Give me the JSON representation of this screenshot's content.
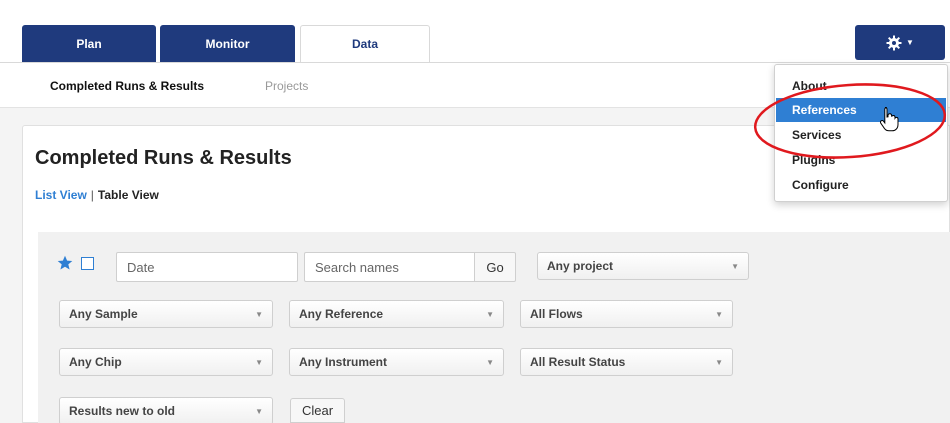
{
  "tabs": [
    {
      "label": "Plan",
      "active": false
    },
    {
      "label": "Monitor",
      "active": false
    },
    {
      "label": "Data",
      "active": true
    }
  ],
  "subnav": {
    "current": "Completed Runs & Results",
    "other": "Projects"
  },
  "page": {
    "title": "Completed Runs & Results",
    "list_view": "List View",
    "separator": "|",
    "table_view": "Table View"
  },
  "filters": {
    "date_placeholder": "Date",
    "search_placeholder": "Search names",
    "go_label": "Go",
    "project": "Any project",
    "sample": "Any Sample",
    "reference": "Any Reference",
    "flows": "All Flows",
    "chip": "Any Chip",
    "instrument": "Any Instrument",
    "result_status": "All Result Status",
    "sort": "Results new to old",
    "clear_label": "Clear"
  },
  "settings_menu": {
    "items": [
      {
        "label": "About"
      },
      {
        "label": "References",
        "highlighted": true
      },
      {
        "label": "Services"
      },
      {
        "label": "Plugins"
      },
      {
        "label": "Configure"
      }
    ]
  },
  "icons": {
    "settings": "gear-icon",
    "favorite": "star-icon",
    "cursor": "hand-pointer-icon"
  },
  "colors": {
    "nav_dark": "#1f3a7d",
    "link_blue": "#2f7fd3",
    "highlight": "#2f7fd3",
    "annotation_red": "#e0191e"
  }
}
